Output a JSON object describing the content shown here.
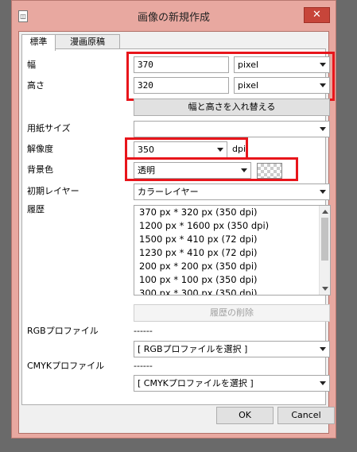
{
  "window": {
    "title": "画像の新規作成",
    "close_label": "✕",
    "icon_glyph": "◫"
  },
  "tabs": [
    {
      "label": "標準"
    },
    {
      "label": "漫画原稿"
    }
  ],
  "width": {
    "label": "幅",
    "value": "370",
    "unit": "pixel"
  },
  "height": {
    "label": "高さ",
    "value": "320",
    "unit": "pixel"
  },
  "swap_button": "幅と高さを入れ替える",
  "paper_size": {
    "label": "用紙サイズ",
    "value": ""
  },
  "resolution": {
    "label": "解像度",
    "value": "350",
    "unit": "dpi"
  },
  "background": {
    "label": "背景色",
    "value": "透明"
  },
  "initial_layer": {
    "label": "初期レイヤー",
    "value": "カラーレイヤー"
  },
  "history": {
    "label": "履歴",
    "items": [
      "370 px * 320 px (350 dpi)",
      "1200 px * 1600 px (350 dpi)",
      "1500 px * 410 px (72 dpi)",
      "1230 px * 410 px (72 dpi)",
      "200 px * 200 px (350 dpi)",
      "100 px * 100 px (350 dpi)",
      "300 px * 300 px (350 dpi)"
    ],
    "delete_button": "履歴の削除"
  },
  "rgb_profile": {
    "label": "RGBプロファイル",
    "current": "------",
    "select": "[ RGBプロファイルを選択 ]"
  },
  "cmyk_profile": {
    "label": "CMYKプロファイル",
    "current": "------",
    "select": "[ CMYKプロファイルを選択 ]"
  },
  "buttons": {
    "ok": "OK",
    "cancel": "Cancel"
  },
  "colors": {
    "highlight": "#e8151b",
    "frame": "#e8a8a0"
  }
}
